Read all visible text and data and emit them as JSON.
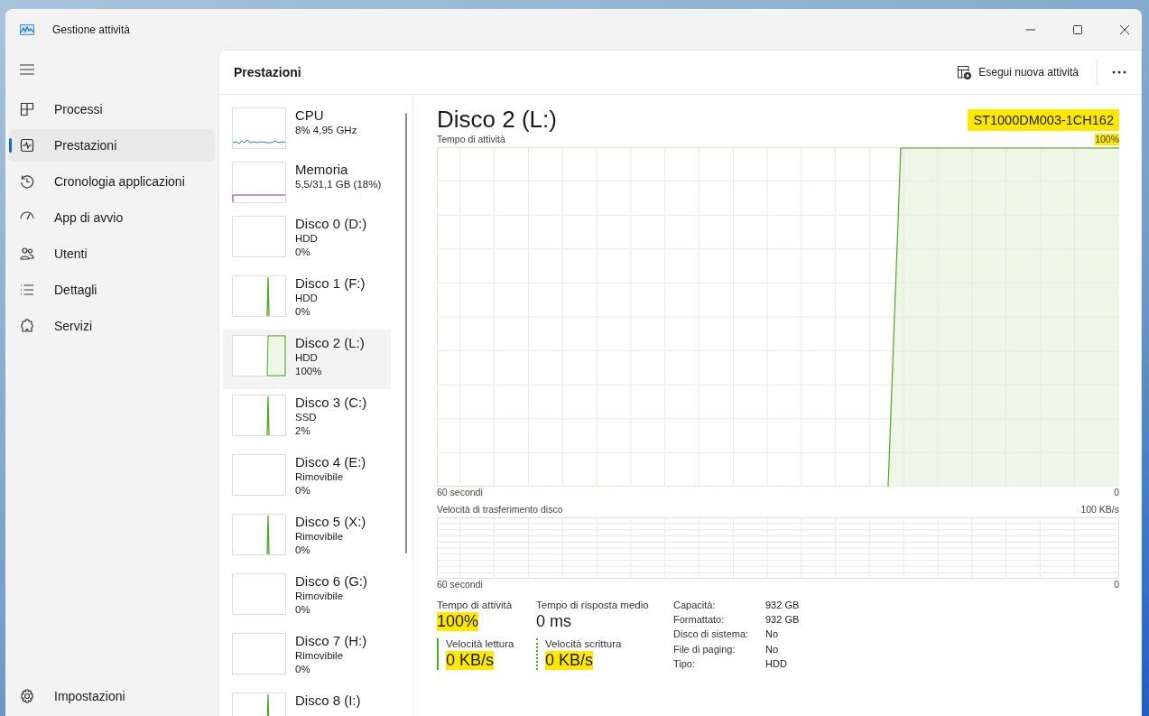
{
  "window": {
    "title": "Gestione attività"
  },
  "nav": {
    "items": [
      {
        "label": "Processi",
        "kind": "processes",
        "selected": false
      },
      {
        "label": "Prestazioni",
        "kind": "performance",
        "selected": true
      },
      {
        "label": "Cronologia applicazioni",
        "kind": "history",
        "selected": false
      },
      {
        "label": "App di avvio",
        "kind": "startup",
        "selected": false
      },
      {
        "label": "Utenti",
        "kind": "users",
        "selected": false
      },
      {
        "label": "Dettagli",
        "kind": "details",
        "selected": false
      },
      {
        "label": "Servizi",
        "kind": "services",
        "selected": false
      }
    ],
    "settings": {
      "label": "Impostazioni"
    }
  },
  "page": {
    "title": "Prestazioni",
    "run_task": "Esegui nuova attività"
  },
  "devices": [
    {
      "name": "CPU",
      "lines": [
        "8% 4,95 GHz"
      ],
      "kind": "cpu",
      "selected": false
    },
    {
      "name": "Memoria",
      "lines": [
        "5,5/31,1 GB (18%)"
      ],
      "kind": "memory",
      "selected": false
    },
    {
      "name": "Disco 0 (D:)",
      "lines": [
        "HDD",
        "0%"
      ],
      "kind": "flat",
      "selected": false
    },
    {
      "name": "Disco 1 (F:)",
      "lines": [
        "HDD",
        "0%"
      ],
      "kind": "spike",
      "selected": false
    },
    {
      "name": "Disco 2 (L:)",
      "lines": [
        "HDD",
        "100%"
      ],
      "kind": "rise",
      "selected": true
    },
    {
      "name": "Disco 3 (C:)",
      "lines": [
        "SSD",
        "2%"
      ],
      "kind": "spike",
      "selected": false
    },
    {
      "name": "Disco 4 (E:)",
      "lines": [
        "Rimovibile",
        "0%"
      ],
      "kind": "flat",
      "selected": false
    },
    {
      "name": "Disco 5 (X:)",
      "lines": [
        "Rimovibile",
        "0%"
      ],
      "kind": "spike",
      "selected": false
    },
    {
      "name": "Disco 6 (G:)",
      "lines": [
        "Rimovibile",
        "0%"
      ],
      "kind": "flat",
      "selected": false
    },
    {
      "name": "Disco 7 (H:)",
      "lines": [
        "Rimovibile",
        "0%"
      ],
      "kind": "flat",
      "selected": false
    },
    {
      "name": "Disco 8 (I:)",
      "kind": "spike",
      "selected": false
    }
  ],
  "detail": {
    "title": "Disco 2 (L:)",
    "model": {
      "text": "ST1000DM003-1CH162",
      "highlighted": true
    },
    "activity_chart": {
      "label": "Tempo di attività",
      "max": {
        "text": "100%",
        "highlighted": true
      },
      "x_start": "60 secondi",
      "x_end": "0"
    },
    "transfer_chart": {
      "label": "Velocità di trasferimento disco",
      "max": {
        "text": "100 KB/s",
        "highlighted": false
      },
      "x_start": "60 secondi",
      "x_end": "0"
    },
    "stats": [
      {
        "label": "Tempo di attività",
        "value": "100%",
        "highlighted": true,
        "kind": "plain"
      },
      {
        "label": "Tempo di risposta medio",
        "value": "0 ms",
        "highlighted": false,
        "kind": "plain"
      },
      {
        "label": "Velocità lettura",
        "value": "0 KB/s",
        "highlighted": true,
        "kind": "read"
      },
      {
        "label": "Velocità scrittura",
        "value": "0 KB/s",
        "highlighted": true,
        "kind": "write"
      }
    ],
    "properties": [
      {
        "label": "Capacità:",
        "value": "932 GB"
      },
      {
        "label": "Formattato:",
        "value": "932 GB"
      },
      {
        "label": "Disco di sistema:",
        "value": "No"
      },
      {
        "label": "File di paging:",
        "value": "No"
      },
      {
        "label": "Tipo:",
        "value": "HDD"
      }
    ]
  }
}
